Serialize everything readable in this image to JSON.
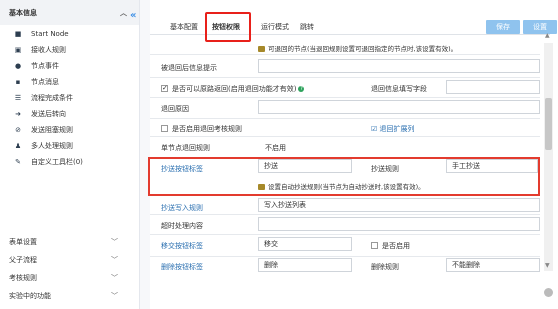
{
  "sidebar": {
    "header": "基本信息",
    "items": [
      {
        "label": "Start Node",
        "icon": "node-icon"
      },
      {
        "label": "接收人规则",
        "icon": "users-icon"
      },
      {
        "label": "节点事件",
        "icon": "event-icon"
      },
      {
        "label": "节点消息",
        "icon": "message-icon"
      },
      {
        "label": "流程完成条件",
        "icon": "list-icon"
      },
      {
        "label": "发送后转向",
        "icon": "redirect-icon"
      },
      {
        "label": "发送阻塞规则",
        "icon": "block-icon"
      },
      {
        "label": "多人处理规则",
        "icon": "multi-user-icon"
      },
      {
        "label": "自定义工具栏(0)",
        "icon": "toolbar-icon"
      }
    ],
    "sections": [
      "表单设置",
      "父子流程",
      "考核规则",
      "实验中的功能"
    ]
  },
  "tabs": [
    "基本配置",
    "按钮权限",
    "运行模式",
    "跳转"
  ],
  "active_tab": "按钮权限",
  "buttons": {
    "save": "保存",
    "settings": "设置"
  },
  "form": {
    "hint1": "可退回的节点(当退回规则设置可退回指定的节点时,该设置有效)。",
    "return_info_label": "被退回后信息提示",
    "can_return_original": "是否可以原路返回(启用退回功能才有效)",
    "return_field_label": "退回信息填写字段",
    "return_reason_label": "退回原因",
    "enable_return_assess": "是否启用退回考核规则",
    "return_ext_link": "退回扩展列",
    "single_return_label": "单节点退回规则",
    "single_return_value": "不启用",
    "cc_button_label": "抄送按钮标签",
    "cc_button_value": "抄送",
    "cc_rule_label": "抄送规则",
    "cc_rule_value": "手工抄送",
    "hint2": "设置自动抄送规则(当节点为自动抄送时,该设置有效)。",
    "cc_write_rule_label": "抄送写入规则",
    "cc_write_rule_value": "写入抄送列表",
    "timeout_label": "超时处理内容",
    "transfer_label": "移交按钮标签",
    "transfer_value": "移交",
    "transfer_enable": "是否启用",
    "delete_label": "删除按钮标签",
    "delete_value": "删除",
    "delete_rule_label": "删除规则",
    "delete_rule_value": "不能删除"
  }
}
